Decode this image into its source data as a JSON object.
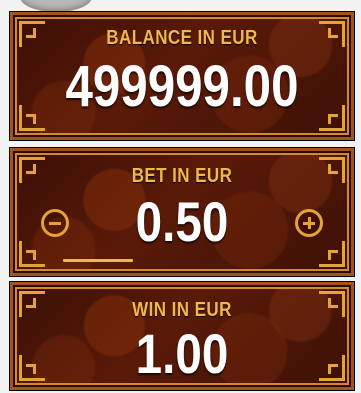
{
  "balance": {
    "label": "BALANCE IN EUR",
    "value": "499999.00"
  },
  "bet": {
    "label": "BET IN EUR",
    "value": "0.50",
    "minus_icon": "minus-circle-icon",
    "plus_icon": "plus-circle-icon"
  },
  "win": {
    "label": "WIN IN EUR",
    "value": "1.00"
  },
  "colors": {
    "accent": "#e3a336",
    "label": "#f0b84a",
    "value": "#ffffff",
    "panel": "#4a1507"
  }
}
